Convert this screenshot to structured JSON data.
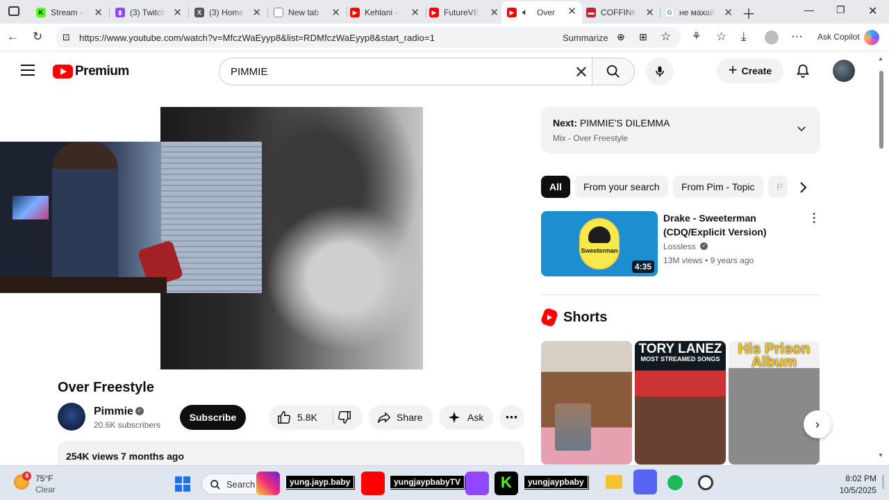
{
  "browser": {
    "tabs": [
      {
        "title": "Stream - K",
        "favicon": "kick",
        "color": "#53fc18"
      },
      {
        "title": "(3) Twitch",
        "favicon": "twitch",
        "color": "#9146ff"
      },
      {
        "title": "(3) Home",
        "favicon": "x",
        "color": "#555555"
      },
      {
        "title": "New tab",
        "favicon": "edge-newtab",
        "color": "#888888"
      },
      {
        "title": "Kehlani - ",
        "favicon": "youtube",
        "color": "#ff0000"
      },
      {
        "title": "FutureVEV",
        "favicon": "youtube",
        "color": "#ff0000"
      },
      {
        "title": "Over",
        "favicon": "youtube",
        "color": "#ff0000",
        "active": true
      },
      {
        "title": "COFFINK",
        "favicon": "coffink",
        "color": "#c41e3a"
      },
      {
        "title": "не махай",
        "favicon": "google",
        "color": "#4285f4"
      }
    ],
    "url": "https://www.youtube.com/watch?v=MfczWaEyyp8&list=RDMfczWaEyyp8&start_radio=1",
    "summarize_label": "Summarize",
    "copilot_label": "Ask Copilot"
  },
  "youtube": {
    "brand": "Premium",
    "search_value": "PIMMIE",
    "create_label": "Create",
    "video": {
      "title": "Over Freestyle",
      "channel": "Pimmie",
      "subscribers": "20.6K subscribers",
      "subscribe_label": "Subscribe",
      "likes": "5.8K",
      "share_label": "Share",
      "ask_label": "Ask",
      "views": "254K views",
      "posted": "7 months ago"
    },
    "sidebar": {
      "next_prefix": "Next:",
      "next_title": "PIMMIE'S DILEMMA",
      "next_sub": "Mix - Over Freestyle",
      "chips": [
        "All",
        "From your search",
        "From Pim - Topic",
        "P"
      ],
      "recommended": {
        "title": "Drake - Sweeterman (CDQ/Explicit Version)",
        "thumb_text": "Sweeterman",
        "channel": "Lossless",
        "views": "13M views",
        "age": "9 years ago",
        "duration": "4:35"
      },
      "shorts_label": "Shorts",
      "shorts": [
        {
          "line1": "",
          "line2": ""
        },
        {
          "line1": "TORY LANEZ",
          "line2": "MOST STREAMED SONGS"
        },
        {
          "line1": "His Prison",
          "line2": "Album"
        }
      ]
    }
  },
  "taskbar": {
    "temperature": "75°F",
    "condition": "Clear",
    "weather_badge": "4",
    "search_label": "Search",
    "handles": [
      "yung.jayp.baby",
      "yungjaypbabyTV",
      "yungjaypbaby"
    ],
    "time": "8:02 PM",
    "date": "10/5/2025"
  }
}
